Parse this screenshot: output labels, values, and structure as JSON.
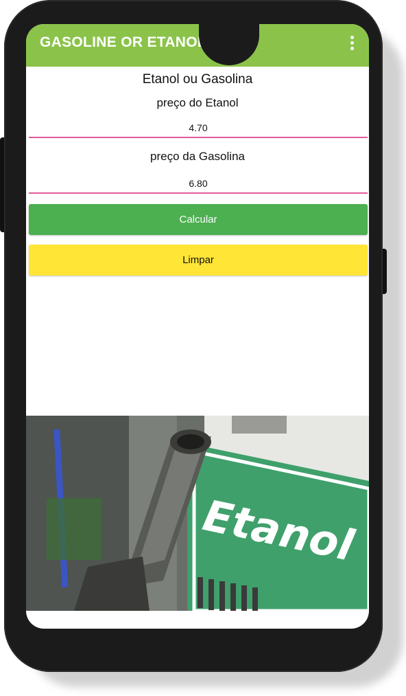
{
  "app": {
    "title": "GASOLINE OR ETANOL?",
    "menu_icon": "overflow-menu-icon"
  },
  "form": {
    "heading": "Etanol ou Gasolina",
    "etanol_label": "preço do Etanol",
    "etanol_value": "4.70",
    "gasolina_label": "preço da Gasolina",
    "gasolina_value": "6.80"
  },
  "buttons": {
    "calculate_label": "Calcular",
    "clear_label": "Limpar"
  },
  "image": {
    "sign_text": "Etanol"
  },
  "colors": {
    "app_bar": "#8bc34a",
    "calculate_button": "#4caf50",
    "clear_button": "#ffe535",
    "input_underline": "#e05c9a"
  }
}
